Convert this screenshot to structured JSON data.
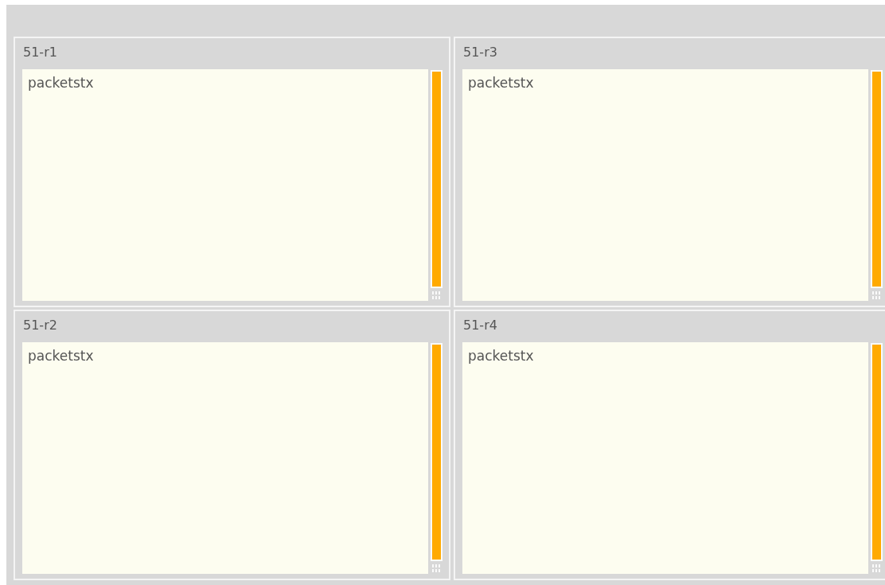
{
  "panels": [
    {
      "title": "51-r1",
      "text": "packetstx"
    },
    {
      "title": "51-r3",
      "text": "packetstx"
    },
    {
      "title": "51-r2",
      "text": "packetstx"
    },
    {
      "title": "51-r4",
      "text": "packetstx"
    }
  ]
}
